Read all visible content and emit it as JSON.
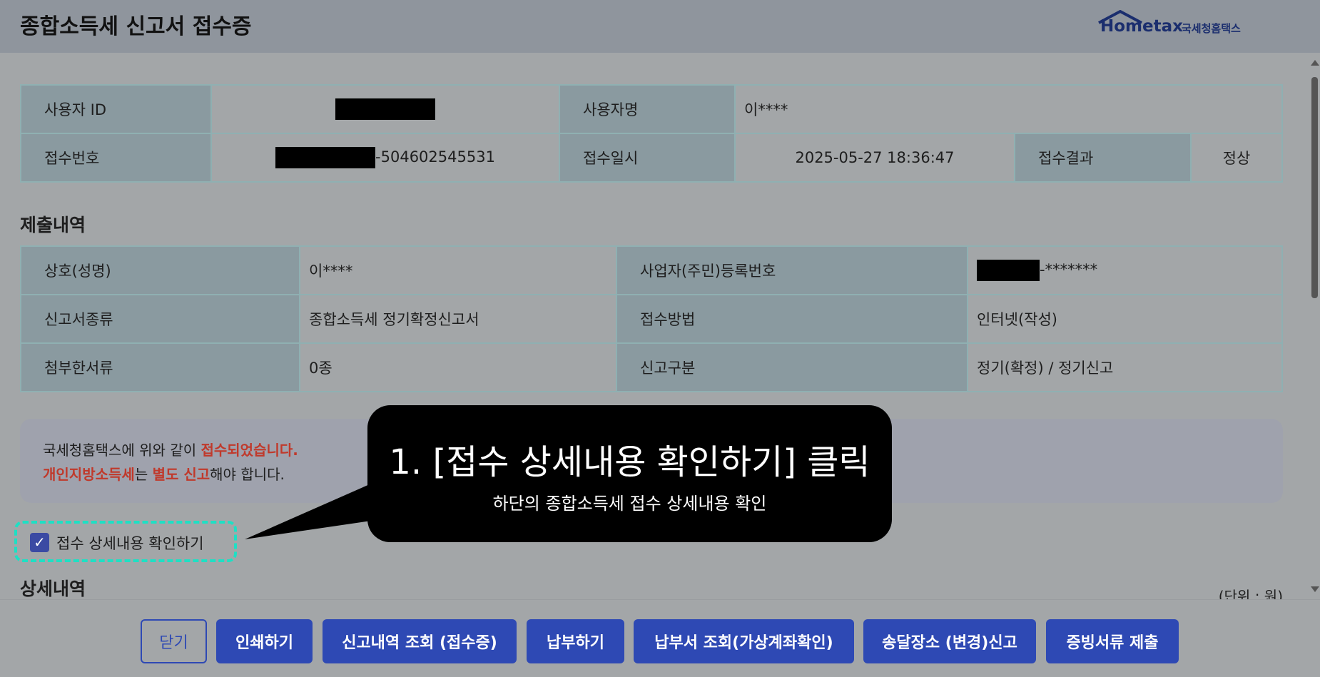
{
  "header": {
    "title": "종합소득세 신고서 접수증",
    "logo_text": "Hometax",
    "logo_sub": "국세청홈택스"
  },
  "receipt": {
    "user_id_label": "사용자 ID",
    "user_name_label": "사용자명",
    "user_name": "이****",
    "receipt_no_label": "접수번호",
    "receipt_no_suffix": "-504602545531",
    "receipt_time_label": "접수일시",
    "receipt_time": "2025-05-27 18:36:47",
    "receipt_result_label": "접수결과",
    "receipt_result": "정상"
  },
  "submission": {
    "section_title": "제출내역",
    "company_label": "상호(성명)",
    "company": "이****",
    "regno_label": "사업자(주민)등록번호",
    "regno_suffix": "-*******",
    "form_type_label": "신고서종류",
    "form_type": "종합소득세 정기확정신고서",
    "method_label": "접수방법",
    "method": "인터넷(작성)",
    "attach_label": "첨부한서류",
    "attach": "0종",
    "category_label": "신고구분",
    "category": "정기(확정) / 정기신고"
  },
  "notice": {
    "line1_a": "국세청홈택스에 위와 같이 ",
    "line1_b": "접수되었습니다.",
    "line2_a": "개인지방소득세",
    "line2_b": "는 ",
    "line2_c": "별도 신고",
    "line2_d": "해야 합니다."
  },
  "detail_check": {
    "label": "접수 상세내용 확인하기",
    "checked": true
  },
  "detail": {
    "section_title": "상세내역",
    "unit": "(단위 : 원)"
  },
  "callout": {
    "title": "1. [접수 상세내용 확인하기] 클릭",
    "subtitle": "하단의 종합소득세 접수 상세내용 확인"
  },
  "footer": {
    "close": "닫기",
    "print": "인쇄하기",
    "history": "신고내역 조회 (접수증)",
    "pay": "납부하기",
    "bill": "납부서 조회(가상계좌확인)",
    "address": "송달장소 (변경)신고",
    "docs": "증빙서류 제출"
  },
  "colors": {
    "accent": "#2e49b4",
    "highlight": "#1ee0c4",
    "alert": "#c0392b"
  }
}
